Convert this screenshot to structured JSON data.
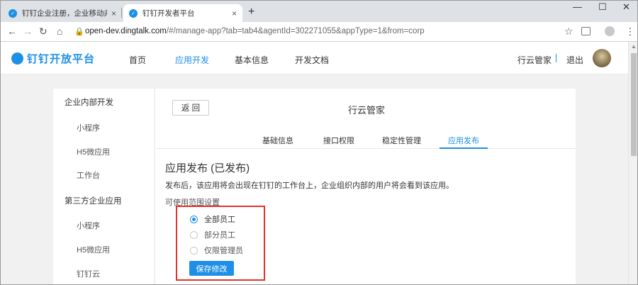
{
  "browser": {
    "tabs": [
      {
        "title": "钉钉企业注册，企业移动办公，…",
        "close": "×"
      },
      {
        "title": "钉钉开发者平台",
        "close": "×"
      }
    ],
    "new_tab": "+",
    "window_controls": {
      "minimize": "—",
      "maximize": "☐",
      "close": "✕"
    },
    "nav": {
      "back": "←",
      "forward": "→",
      "reload": "↻",
      "home": "⌂"
    },
    "url_host": "open-dev.dingtalk.com",
    "url_path": "/#/manage-app?tab=tab4&agentId=302271055&appType=1&from=corp",
    "lock": "🔒",
    "bookmark_star": "☆",
    "menu": "⋮"
  },
  "header": {
    "logo_text": "钉钉开放平台",
    "nav": [
      "首页",
      "应用开发",
      "基本信息",
      "开发文档"
    ],
    "active_nav": "应用开发",
    "user_name": "行云管家",
    "logout": "退出"
  },
  "sidebar": {
    "groups": [
      {
        "title": "企业内部开发",
        "items": [
          "小程序",
          "H5微应用",
          "工作台"
        ]
      },
      {
        "title": "第三方企业应用",
        "items": [
          "小程序",
          "H5微应用",
          "钉钉云"
        ]
      }
    ]
  },
  "main": {
    "back_label": "返 回",
    "app_title": "行云管家",
    "tabs": [
      "基础信息",
      "接口权限",
      "稳定性管理",
      "应用发布"
    ],
    "active_tab": "应用发布",
    "section_title": "应用发布 (已发布)",
    "section_desc": "发布后，该应用将会出现在钉钉的工作台上，企业组织内部的用户将会看到该应用。",
    "scope_label": "可使用范围设置",
    "options": [
      {
        "label": "全部员工",
        "checked": true
      },
      {
        "label": "部分员工",
        "checked": false
      },
      {
        "label": "仅限管理员",
        "checked": false
      }
    ],
    "save_label": "保存修改"
  },
  "colors": {
    "accent": "#1e8fe6",
    "highlight": "#e4312b"
  }
}
